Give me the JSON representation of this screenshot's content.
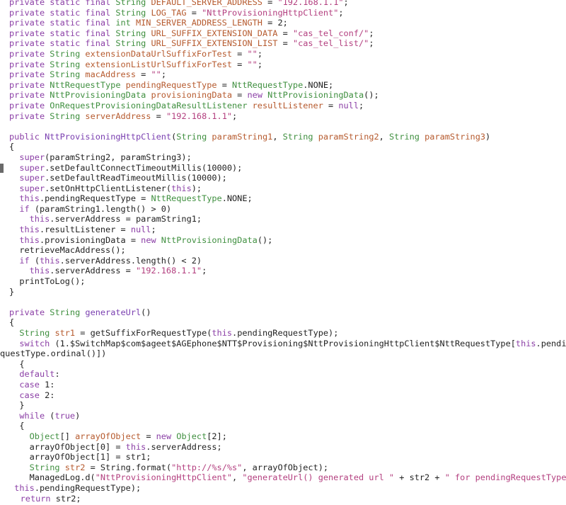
{
  "colors": {
    "keyword": "#8b3fa6",
    "type": "#3f8f3f",
    "function": "#7a3fb0",
    "identifier": "#b65a2e",
    "string": "#b33f7f",
    "constant": "#2f5fa8",
    "plain": "#222222",
    "background": "#ffffff"
  },
  "editor": {
    "gutter_mark_line": 16,
    "lines": [
      [
        [
          "kw",
          "private static final "
        ],
        [
          "ty",
          "String "
        ],
        [
          "id",
          "DEFAULT_SERVER_ADDRESS"
        ],
        [
          "op",
          " = "
        ],
        [
          "str",
          "\"192.168.1.1\""
        ],
        [
          "op",
          ";"
        ]
      ],
      [
        [
          "kw",
          "private static final "
        ],
        [
          "ty",
          "String "
        ],
        [
          "id",
          "LOG_TAG"
        ],
        [
          "op",
          " = "
        ],
        [
          "str",
          "\"NttProvisioningHttpClient\""
        ],
        [
          "op",
          ";"
        ]
      ],
      [
        [
          "kw",
          "private static final "
        ],
        [
          "ty",
          "int "
        ],
        [
          "id",
          "MIN_SERVER_ADDRESS_LENGTH"
        ],
        [
          "op",
          " = 2;"
        ]
      ],
      [
        [
          "kw",
          "private static final "
        ],
        [
          "ty",
          "String "
        ],
        [
          "id",
          "URL_SUFFIX_EXTENSION_DATA"
        ],
        [
          "op",
          " = "
        ],
        [
          "str",
          "\"cas_tel_conf/\""
        ],
        [
          "op",
          ";"
        ]
      ],
      [
        [
          "kw",
          "private static final "
        ],
        [
          "ty",
          "String "
        ],
        [
          "id",
          "URL_SUFFIX_EXTENSION_LIST"
        ],
        [
          "op",
          " = "
        ],
        [
          "str",
          "\"cas_tel_list/\""
        ],
        [
          "op",
          ";"
        ]
      ],
      [
        [
          "kw",
          "private "
        ],
        [
          "ty",
          "String "
        ],
        [
          "id",
          "extensionDataUrlSuffixForTest"
        ],
        [
          "op",
          " = "
        ],
        [
          "str",
          "\"\""
        ],
        [
          "op",
          ";"
        ]
      ],
      [
        [
          "kw",
          "private "
        ],
        [
          "ty",
          "String "
        ],
        [
          "id",
          "extensionListUrlSuffixForTest"
        ],
        [
          "op",
          " = "
        ],
        [
          "str",
          "\"\""
        ],
        [
          "op",
          ";"
        ]
      ],
      [
        [
          "kw",
          "private "
        ],
        [
          "ty",
          "String "
        ],
        [
          "id",
          "macAddress"
        ],
        [
          "op",
          " = "
        ],
        [
          "str",
          "\"\""
        ],
        [
          "op",
          ";"
        ]
      ],
      [
        [
          "kw",
          "private "
        ],
        [
          "ty",
          "NttRequestType "
        ],
        [
          "id",
          "pendingRequestType"
        ],
        [
          "op",
          " = "
        ],
        [
          "ty",
          "NttRequestType"
        ],
        [
          "op",
          ".NONE;"
        ]
      ],
      [
        [
          "kw",
          "private "
        ],
        [
          "ty",
          "NttProvisioningData "
        ],
        [
          "id",
          "provisioningData"
        ],
        [
          "op",
          " = "
        ],
        [
          "kw",
          "new "
        ],
        [
          "ty",
          "NttProvisioningData"
        ],
        [
          "op",
          "();"
        ]
      ],
      [
        [
          "kw",
          "private "
        ],
        [
          "ty",
          "OnRequestProvisioningDataResultListener "
        ],
        [
          "id",
          "resultListener"
        ],
        [
          "op",
          " = "
        ],
        [
          "kw",
          "null"
        ],
        [
          "op",
          ";"
        ]
      ],
      [
        [
          "kw",
          "private "
        ],
        [
          "ty",
          "String "
        ],
        [
          "id",
          "serverAddress"
        ],
        [
          "op",
          " = "
        ],
        [
          "str",
          "\"192.168.1.1\""
        ],
        [
          "op",
          ";"
        ]
      ],
      [],
      [
        [
          "kw",
          "public "
        ],
        [
          "fn",
          "NttProvisioningHttpClient"
        ],
        [
          "op",
          "("
        ],
        [
          "ty",
          "String "
        ],
        [
          "id",
          "paramString1"
        ],
        [
          "op",
          ", "
        ],
        [
          "ty",
          "String "
        ],
        [
          "id",
          "paramString2"
        ],
        [
          "op",
          ", "
        ],
        [
          "ty",
          "String "
        ],
        [
          "id",
          "paramString3"
        ],
        [
          "op",
          ")"
        ]
      ],
      [
        [
          "op",
          "{"
        ]
      ],
      [
        [
          "op",
          "  "
        ],
        [
          "kw",
          "super"
        ],
        [
          "op",
          "(paramString2, paramString3);"
        ]
      ],
      [
        [
          "op",
          "  "
        ],
        [
          "kw",
          "super"
        ],
        [
          "op",
          ".setDefaultConnectTimeoutMillis(10000);"
        ]
      ],
      [
        [
          "op",
          "  "
        ],
        [
          "kw",
          "super"
        ],
        [
          "op",
          ".setDefaultReadTimeoutMillis(10000);"
        ]
      ],
      [
        [
          "op",
          "  "
        ],
        [
          "kw",
          "super"
        ],
        [
          "op",
          ".setOnHttpClientListener("
        ],
        [
          "kw",
          "this"
        ],
        [
          "op",
          ");"
        ]
      ],
      [
        [
          "op",
          "  "
        ],
        [
          "kw",
          "this"
        ],
        [
          "op",
          ".pendingRequestType = "
        ],
        [
          "ty",
          "NttRequestType"
        ],
        [
          "op",
          ".NONE;"
        ]
      ],
      [
        [
          "op",
          "  "
        ],
        [
          "kw",
          "if "
        ],
        [
          "op",
          "(paramString1.length() > 0)"
        ]
      ],
      [
        [
          "op",
          "    "
        ],
        [
          "kw",
          "this"
        ],
        [
          "op",
          ".serverAddress = paramString1;"
        ]
      ],
      [
        [
          "op",
          "  "
        ],
        [
          "kw",
          "this"
        ],
        [
          "op",
          ".resultListener = "
        ],
        [
          "kw",
          "null"
        ],
        [
          "op",
          ";"
        ]
      ],
      [
        [
          "op",
          "  "
        ],
        [
          "kw",
          "this"
        ],
        [
          "op",
          ".provisioningData = "
        ],
        [
          "kw",
          "new "
        ],
        [
          "ty",
          "NttProvisioningData"
        ],
        [
          "op",
          "();"
        ]
      ],
      [
        [
          "op",
          "  retrieveMacAddress();"
        ]
      ],
      [
        [
          "op",
          "  "
        ],
        [
          "kw",
          "if "
        ],
        [
          "op",
          "("
        ],
        [
          "kw",
          "this"
        ],
        [
          "op",
          ".serverAddress.length() < 2)"
        ]
      ],
      [
        [
          "op",
          "    "
        ],
        [
          "kw",
          "this"
        ],
        [
          "op",
          ".serverAddress = "
        ],
        [
          "str",
          "\"192.168.1.1\""
        ],
        [
          "op",
          ";"
        ]
      ],
      [
        [
          "op",
          "  printToLog();"
        ]
      ],
      [
        [
          "op",
          "}"
        ]
      ],
      [],
      [
        [
          "kw",
          "private "
        ],
        [
          "ty",
          "String "
        ],
        [
          "fn",
          "generateUrl"
        ],
        [
          "op",
          "()"
        ]
      ],
      [
        [
          "op",
          "{"
        ]
      ],
      [
        [
          "op",
          "  "
        ],
        [
          "ty",
          "String "
        ],
        [
          "id",
          "str1"
        ],
        [
          "op",
          " = getSuffixForRequestType("
        ],
        [
          "kw",
          "this"
        ],
        [
          "op",
          ".pendingRequestType);"
        ]
      ],
      [
        [
          "op",
          "  "
        ],
        [
          "kw",
          "switch "
        ],
        [
          "op",
          "(1.$SwitchMap$com$ageet$AGEphone$NTT$Provisioning$NttProvisioningHttpClient$NttRequestType["
        ],
        [
          "kw",
          "this"
        ],
        [
          "op",
          ".pendingRe"
        ]
      ],
      [
        [
          "op",
          "questType.ordinal()])"
        ]
      ],
      [
        [
          "op",
          "  {"
        ]
      ],
      [
        [
          "op",
          "  "
        ],
        [
          "kw",
          "default"
        ],
        [
          "op",
          ":"
        ]
      ],
      [
        [
          "op",
          "  "
        ],
        [
          "kw",
          "case "
        ],
        [
          "op",
          "1:"
        ]
      ],
      [
        [
          "op",
          "  "
        ],
        [
          "kw",
          "case "
        ],
        [
          "op",
          "2:"
        ]
      ],
      [
        [
          "op",
          "  }"
        ]
      ],
      [
        [
          "op",
          "  "
        ],
        [
          "kw",
          "while "
        ],
        [
          "op",
          "("
        ],
        [
          "kw",
          "true"
        ],
        [
          "op",
          ")"
        ]
      ],
      [
        [
          "op",
          "  {"
        ]
      ],
      [
        [
          "op",
          "    "
        ],
        [
          "ty",
          "Object"
        ],
        [
          "op",
          "[] "
        ],
        [
          "id",
          "arrayOfObject"
        ],
        [
          "op",
          " = "
        ],
        [
          "kw",
          "new "
        ],
        [
          "ty",
          "Object"
        ],
        [
          "op",
          "[2];"
        ]
      ],
      [
        [
          "op",
          "    arrayOfObject[0] = "
        ],
        [
          "kw",
          "this"
        ],
        [
          "op",
          ".serverAddress;"
        ]
      ],
      [
        [
          "op",
          "    arrayOfObject[1] = str1;"
        ]
      ],
      [
        [
          "op",
          "    "
        ],
        [
          "ty",
          "String "
        ],
        [
          "id",
          "str2"
        ],
        [
          "op",
          " = String.format("
        ],
        [
          "str",
          "\"http://%s/%s\""
        ],
        [
          "op",
          ", arrayOfObject);"
        ]
      ],
      [
        [
          "op",
          "    ManagedLog.d("
        ],
        [
          "str",
          "\"NttProvisioningHttpClient\""
        ],
        [
          "op",
          ", "
        ],
        [
          "str",
          "\"generateUrl() generated url \""
        ],
        [
          "op",
          " + str2 + "
        ],
        [
          "str",
          "\" for pendingRequestType \""
        ],
        [
          "op",
          " +"
        ]
      ],
      [
        [
          "op",
          " "
        ],
        [
          "kw",
          "this"
        ],
        [
          "op",
          ".pendingRequestType);"
        ]
      ],
      [
        [
          "op",
          "    "
        ],
        [
          "kw",
          "return "
        ],
        [
          "op",
          "str2;"
        ]
      ]
    ]
  }
}
